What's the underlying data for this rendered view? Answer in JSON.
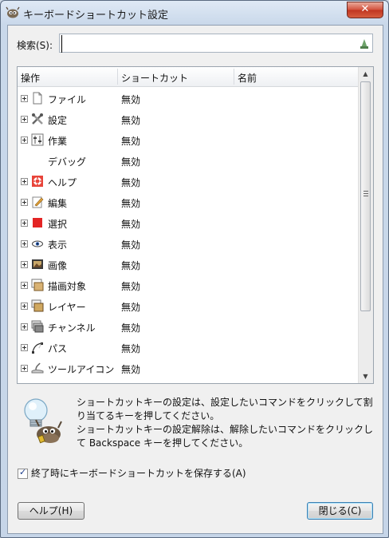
{
  "window": {
    "title": "キーボードショートカット設定",
    "close_glyph": "✕"
  },
  "search": {
    "label": "検索(S):",
    "value": "",
    "placeholder": ""
  },
  "tree": {
    "columns": [
      "操作",
      "ショートカット",
      "名前"
    ],
    "rows": [
      {
        "name": "ファイル",
        "shortcut": "無効",
        "icon": "file-icon",
        "expandable": true
      },
      {
        "name": "設定",
        "shortcut": "無効",
        "icon": "tools-icon",
        "expandable": true
      },
      {
        "name": "作業",
        "shortcut": "無効",
        "icon": "sliders-icon",
        "expandable": true
      },
      {
        "name": "デバッグ",
        "shortcut": "無効",
        "icon": "",
        "expandable": false
      },
      {
        "name": "ヘルプ",
        "shortcut": "無効",
        "icon": "lifebuoy-icon",
        "expandable": true
      },
      {
        "name": "編集",
        "shortcut": "無効",
        "icon": "edit-icon",
        "expandable": true
      },
      {
        "name": "選択",
        "shortcut": "無効",
        "icon": "selection-icon",
        "expandable": true
      },
      {
        "name": "表示",
        "shortcut": "無効",
        "icon": "eye-icon",
        "expandable": true
      },
      {
        "name": "画像",
        "shortcut": "無効",
        "icon": "image-icon",
        "expandable": true
      },
      {
        "name": "描画対象",
        "shortcut": "無効",
        "icon": "drawable-icon",
        "expandable": true
      },
      {
        "name": "レイヤー",
        "shortcut": "無効",
        "icon": "layers-icon",
        "expandable": true
      },
      {
        "name": "チャンネル",
        "shortcut": "無効",
        "icon": "channels-icon",
        "expandable": true
      },
      {
        "name": "パス",
        "shortcut": "無効",
        "icon": "paths-icon",
        "expandable": true
      },
      {
        "name": "ツールアイコン",
        "shortcut": "無効",
        "icon": "tool-icon",
        "expandable": true
      }
    ],
    "scroll_up": "▲",
    "scroll_down": "▼"
  },
  "info": {
    "line1": "ショートカットキーの設定は、設定したいコマンドをクリックして割り当てるキーを押してください。",
    "line2": "ショートカットキーの設定解除は、解除したいコマンドをクリックして Backspace キーを押してください。",
    "icon": "lightbulb-wilber-icon"
  },
  "save_on_exit": {
    "label": "終了時にキーボードショートカットを保存する(A)",
    "checked": true,
    "check_glyph": "✓"
  },
  "buttons": {
    "help": "ヘルプ(H)",
    "close": "閉じる(C)"
  },
  "colors": {
    "selection_red": "#e32424",
    "close_red": "#c9452e"
  }
}
